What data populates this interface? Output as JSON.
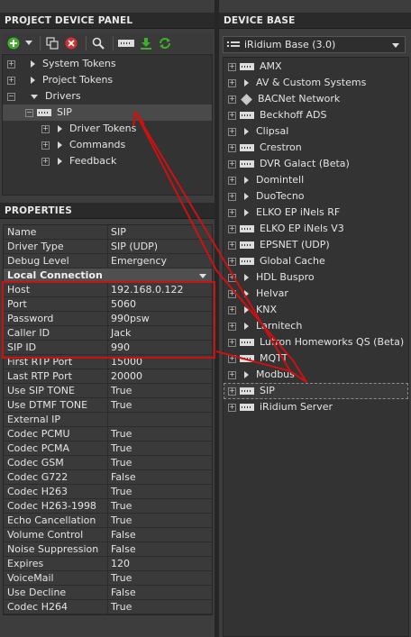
{
  "project_panel": {
    "title": "PROJECT DEVICE PANEL",
    "tree": [
      {
        "label": "System Tokens",
        "level": 0,
        "expander": "+",
        "arrow": "right"
      },
      {
        "label": "Project Tokens",
        "level": 0,
        "expander": "+",
        "arrow": "right"
      },
      {
        "label": "Drivers",
        "level": 0,
        "expander": "−",
        "arrow": "down"
      },
      {
        "label": "SIP",
        "level": 1,
        "expander": "−",
        "icon": "device",
        "selected": true
      },
      {
        "label": "Driver Tokens",
        "level": 2,
        "expander": "+",
        "arrow": "right"
      },
      {
        "label": "Commands",
        "level": 2,
        "expander": "+",
        "arrow": "right"
      },
      {
        "label": "Feedback",
        "level": 2,
        "expander": "+",
        "arrow": "right"
      }
    ]
  },
  "properties": {
    "title": "PROPERTIES",
    "rows_top": [
      {
        "name": "Name",
        "value": "SIP"
      },
      {
        "name": "Driver Type",
        "value": "SIP (UDP)"
      },
      {
        "name": "Debug Level",
        "value": "Emergency"
      }
    ],
    "group_label": "Local Connection",
    "rows_highlight": [
      {
        "name": "Host",
        "value": "192.168.0.122"
      },
      {
        "name": "Port",
        "value": "5060"
      },
      {
        "name": "Password",
        "value": "990psw"
      },
      {
        "name": "Caller ID",
        "value": "Jack"
      },
      {
        "name": "SIP ID",
        "value": "990"
      }
    ],
    "rows_bottom": [
      {
        "name": "First RTP Port",
        "value": "15000"
      },
      {
        "name": "Last RTP Port",
        "value": "20000"
      },
      {
        "name": "Use SIP TONE",
        "value": "True"
      },
      {
        "name": "Use DTMF TONE",
        "value": "True"
      },
      {
        "name": "External IP",
        "value": ""
      },
      {
        "name": "Codec PCMU",
        "value": "True"
      },
      {
        "name": "Codec PCMA",
        "value": "True"
      },
      {
        "name": "Codec GSM",
        "value": "True"
      },
      {
        "name": "Codec G722",
        "value": "False"
      },
      {
        "name": "Codec H263",
        "value": "True"
      },
      {
        "name": "Codec H263-1998",
        "value": "True"
      },
      {
        "name": "Echo Cancellation",
        "value": "True"
      },
      {
        "name": "Volume Control",
        "value": "False"
      },
      {
        "name": "Noise Suppression",
        "value": "False"
      },
      {
        "name": "Expires",
        "value": "120"
      },
      {
        "name": "VoiceMail",
        "value": "True"
      },
      {
        "name": "Use Decline",
        "value": "False"
      },
      {
        "name": "Codec H264",
        "value": "True"
      }
    ]
  },
  "device_base": {
    "title": "DEVICE BASE",
    "dropdown_value": "iRidium Base (3.0)",
    "items": [
      {
        "label": "AMX",
        "icon": "device"
      },
      {
        "label": "AV & Custom Systems",
        "icon": "arrow"
      },
      {
        "label": "BACNet Network",
        "icon": "diamond"
      },
      {
        "label": "Beckhoff ADS",
        "icon": "device"
      },
      {
        "label": "Clipsal",
        "icon": "arrow"
      },
      {
        "label": "Crestron",
        "icon": "device"
      },
      {
        "label": "DVR Galact (Beta)",
        "icon": "device"
      },
      {
        "label": "Domintell",
        "icon": "arrow"
      },
      {
        "label": "DuoTecno",
        "icon": "arrow"
      },
      {
        "label": "ELKO EP iNels RF",
        "icon": "arrow"
      },
      {
        "label": "ELKO EP iNels V3",
        "icon": "device"
      },
      {
        "label": "EPSNET (UDP)",
        "icon": "device"
      },
      {
        "label": "Global Cache",
        "icon": "device"
      },
      {
        "label": "HDL Buspro",
        "icon": "arrow"
      },
      {
        "label": "Helvar",
        "icon": "arrow"
      },
      {
        "label": "KNX",
        "icon": "arrow"
      },
      {
        "label": "Larnitech",
        "icon": "arrow"
      },
      {
        "label": "Lutron Homeworks QS (Beta)",
        "icon": "device"
      },
      {
        "label": "MQTT",
        "icon": "device"
      },
      {
        "label": "Modbus",
        "icon": "arrow"
      },
      {
        "label": "SIP",
        "icon": "device",
        "selected": true
      },
      {
        "label": "iRidium Server",
        "icon": "device"
      }
    ]
  },
  "colors": {
    "highlight_box": "#d01010",
    "tree_background": "#333333",
    "header_background": "#2a2a2a",
    "green_icon": "#3fae2a",
    "red_icon": "#d23030"
  },
  "icons": {
    "toolbar": [
      "add-icon",
      "chevron-down-icon",
      "copy-icon",
      "delete-icon",
      "search-icon",
      "device-icon",
      "download-icon",
      "refresh-icon"
    ],
    "dropdown": "list-icon"
  }
}
